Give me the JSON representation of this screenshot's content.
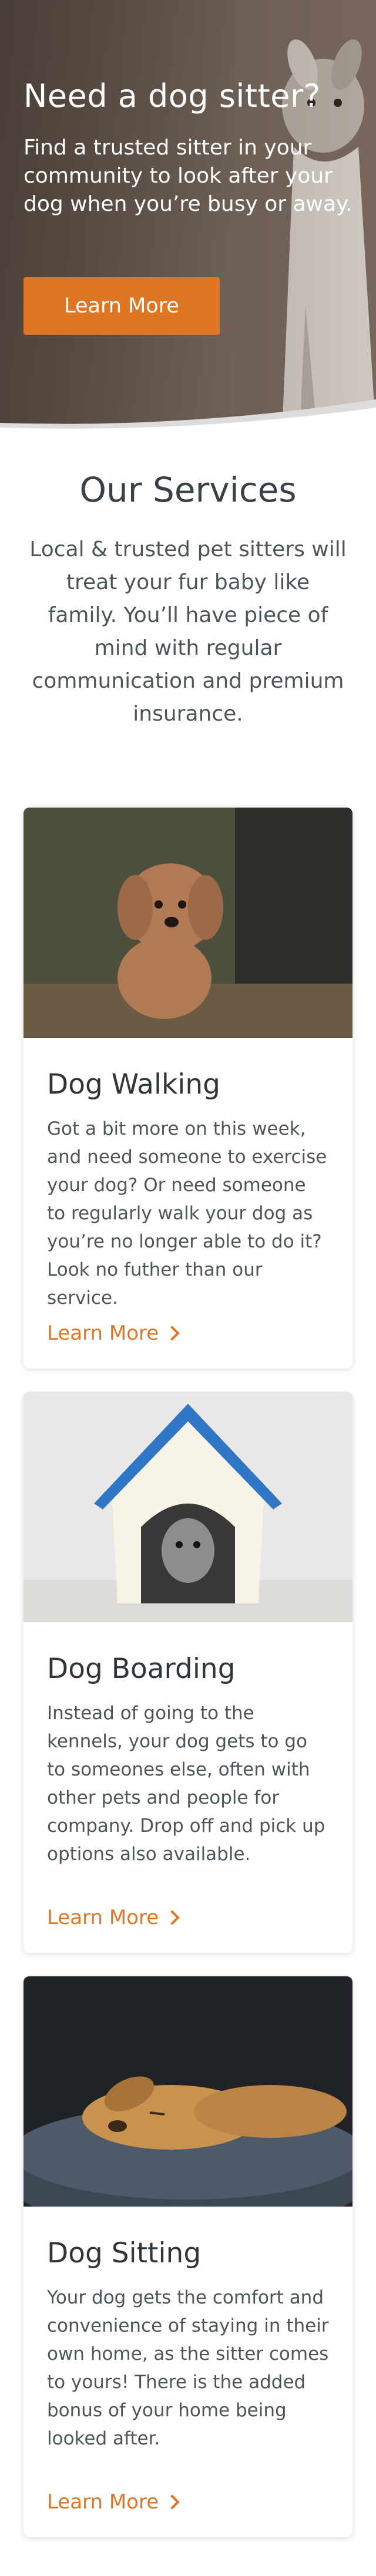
{
  "hero": {
    "title": "Need a dog sitter?",
    "text": "Find a trusted sitter in your community to look after your dog when you’re busy or away.",
    "button_label": "Learn More"
  },
  "services": {
    "title": "Our Services",
    "intro": "Local & trusted pet sitters will treat your fur baby like family. You’ll have piece of mind with regular communication and premium insurance.",
    "cards": [
      {
        "title": "Dog Walking",
        "description": "Got a bit more on this week, and need someone to exercise your dog? Or need someone to regularly walk your dog as you’re no longer able to do it? Look no futher than our service.",
        "link": "Learn More"
      },
      {
        "title": "Dog Boarding",
        "description": "Instead of going to the kennels, your dog gets to go to someones else, often with other pets and people for company. Drop off and pick up options also available.",
        "link": "Learn More"
      },
      {
        "title": "Dog Sitting",
        "description": "Your dog gets the comfort and convenience of staying in their own home, as the sitter comes to yours! There is the added bonus of your home being looked after.",
        "link": "Learn More"
      }
    ]
  },
  "colors": {
    "accent": "#e07624",
    "text": "#3a4146"
  }
}
